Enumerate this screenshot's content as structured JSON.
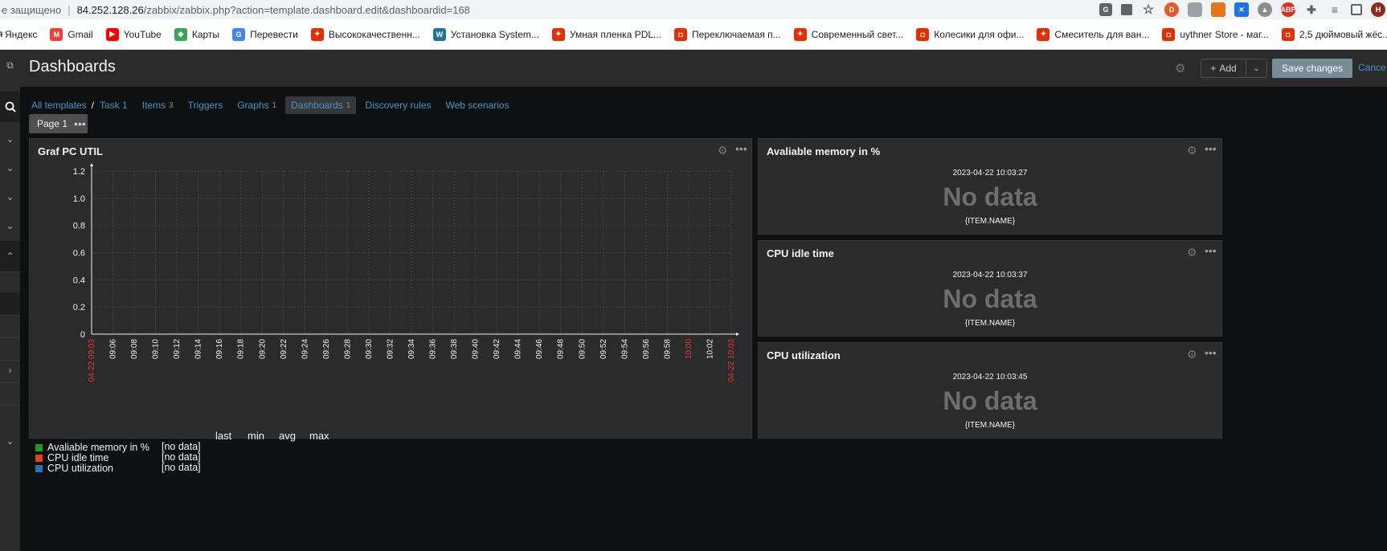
{
  "browser": {
    "insecure_label": "е защищено",
    "url_host": "84.252.128.26",
    "url_path": "/zabbix/zabbix.php?action=template.dashboard.edit&dashboardid=168",
    "profile_initial": "Н",
    "bookmarks": [
      {
        "label": "Яндекс",
        "icon": "yandex-icon",
        "color": "#ffffff"
      },
      {
        "label": "Gmail",
        "icon": "gmail-icon",
        "color": "#ea4335"
      },
      {
        "label": "YouTube",
        "icon": "youtube-icon",
        "color": "#ff0000"
      },
      {
        "label": "Карты",
        "icon": "maps-icon",
        "color": "#34a853"
      },
      {
        "label": "Перевести",
        "icon": "translate-icon",
        "color": "#4285f4"
      },
      {
        "label": "Высококачественн...",
        "icon": "aliexpress-icon",
        "color": "#e62e04"
      },
      {
        "label": "Установка System...",
        "icon": "wordpress-icon",
        "color": "#21759b"
      },
      {
        "label": "Умная пленка PDL...",
        "icon": "aliexpress-icon",
        "color": "#e62e04"
      },
      {
        "label": "Переключаемая п...",
        "icon": "aliexpress-bag-icon",
        "color": "#e62e04"
      },
      {
        "label": "Современный свет...",
        "icon": "aliexpress-icon",
        "color": "#e62e04"
      },
      {
        "label": "Колесики для офи...",
        "icon": "aliexpress-bag-icon",
        "color": "#e62e04"
      },
      {
        "label": "Смеситель для ван...",
        "icon": "aliexpress-icon",
        "color": "#e62e04"
      },
      {
        "label": "uythner Store - маг...",
        "icon": "aliexpress-bag-icon",
        "color": "#e62e04"
      },
      {
        "label": "2,5 дюймовый жёс...",
        "icon": "aliexpress-bag-icon",
        "color": "#e62e04"
      }
    ]
  },
  "header": {
    "title": "Dashboards",
    "add_label": "Add",
    "save_label": "Save changes",
    "cancel_label": "Cance"
  },
  "nav": {
    "all_templates": "All templates",
    "separator": "/",
    "template": "Task 1",
    "items": {
      "label": "Items",
      "count": "3"
    },
    "triggers": {
      "label": "Triggers"
    },
    "graphs": {
      "label": "Graphs",
      "count": "1"
    },
    "dashboards": {
      "label": "Dashboards",
      "count": "1"
    },
    "discovery": {
      "label": "Discovery rules"
    },
    "web": {
      "label": "Web scenarios"
    }
  },
  "page_tab": {
    "label": "Page 1"
  },
  "graph_widget": {
    "title": "Graf PC UTIL",
    "legend_columns": [
      "last",
      "min",
      "avg",
      "max"
    ],
    "legend_items": [
      {
        "name": "Avaliable memory in %",
        "color": "#1a9f1a",
        "value": "[no data]"
      },
      {
        "name": "CPU idle time",
        "color": "#e5401f",
        "value": "[no data]"
      },
      {
        "name": "CPU utilization",
        "color": "#2176b3",
        "value": "[no data]"
      }
    ]
  },
  "chart_data": {
    "type": "line",
    "y_ticks": [
      "0",
      "0.2",
      "0.4",
      "0.6",
      "0.8",
      "1.0",
      "1.2"
    ],
    "ylim": [
      0,
      1.2
    ],
    "x_ticks": [
      "04-22 09:03",
      "09:06",
      "09:08",
      "09:10",
      "09:12",
      "09:14",
      "09:16",
      "09:18",
      "09:20",
      "09:22",
      "09:24",
      "09:26",
      "09:28",
      "09:30",
      "09:32",
      "09:34",
      "09:36",
      "09:38",
      "09:40",
      "09:42",
      "09:44",
      "09:46",
      "09:48",
      "09:50",
      "09:52",
      "09:54",
      "09:56",
      "09:58",
      "10:00",
      "10:02",
      "04-22 10:03"
    ],
    "x_tick_colors": {
      "04-22 09:03": "#e33734",
      "10:00": "#e33734",
      "04-22 10:03": "#e33734"
    },
    "grid": true,
    "series": [
      {
        "name": "Avaliable memory in %",
        "values": []
      },
      {
        "name": "CPU idle time",
        "values": []
      },
      {
        "name": "CPU utilization",
        "values": []
      }
    ]
  },
  "item_widgets": [
    {
      "title": "Avaliable memory in %",
      "time": "2023-04-22 10:03:27",
      "value": "No data",
      "name": "{ITEM.NAME}"
    },
    {
      "title": "CPU idle time",
      "time": "2023-04-22 10:03:37",
      "value": "No data",
      "name": "{ITEM.NAME}"
    },
    {
      "title": "CPU utilization",
      "time": "2023-04-22 10:03:45",
      "value": "No data",
      "name": "{ITEM.NAME}"
    }
  ]
}
